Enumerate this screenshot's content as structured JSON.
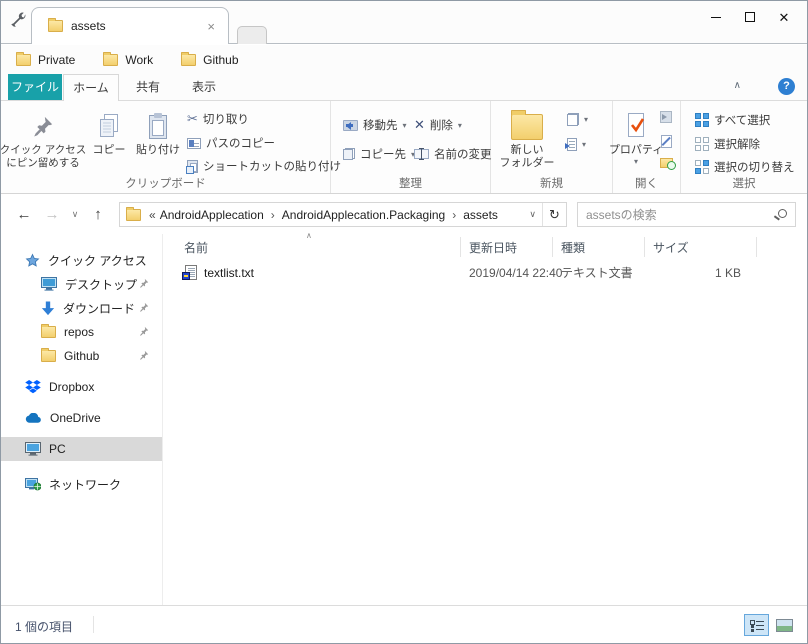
{
  "titlebar": {
    "tab": "assets",
    "bookmarks": [
      "Private",
      "Work",
      "Github"
    ]
  },
  "ribbon": {
    "file_tab": "ファイル",
    "tabs": [
      "ホーム",
      "共有",
      "表示"
    ],
    "pin_quick_access": [
      "クイック アクセス",
      "にピン留めする"
    ],
    "copy": "コピー",
    "paste": "貼り付け",
    "cut": "切り取り",
    "copy_path": "パスのコピー",
    "paste_shortcut": "ショートカットの貼り付け",
    "group_clipboard": "クリップボード",
    "move_to": "移動先",
    "copy_to": "コピー先",
    "delete": "削除",
    "rename": "名前の変更",
    "group_organize": "整理",
    "new_folder": [
      "新しい",
      "フォルダー"
    ],
    "group_new": "新規",
    "properties": "プロパティ",
    "group_open": "開く",
    "select_all": "すべて選択",
    "select_none": "選択解除",
    "invert_selection": "選択の切り替え",
    "group_select": "選択"
  },
  "navbar": {
    "breadcrumbs": [
      "AndroidApplecation",
      "AndroidApplecation.Packaging",
      "assets"
    ],
    "search_placeholder": "assetsの検索"
  },
  "sidebar": {
    "quick_access": "クイック アクセス",
    "pinned": [
      "デスクトップ",
      "ダウンロード",
      "repos",
      "Github"
    ],
    "dropbox": "Dropbox",
    "onedrive": "OneDrive",
    "pc": "PC",
    "network": "ネットワーク"
  },
  "files": {
    "columns": [
      "名前",
      "更新日時",
      "種類",
      "サイズ"
    ],
    "rows": [
      {
        "name": "textlist.txt",
        "modified": "2019/04/14 22:40",
        "type": "テキスト文書",
        "size": "1 KB"
      }
    ]
  },
  "statusbar": {
    "item_count": "1 個の項目"
  },
  "icons": {
    "back_arrow": "←",
    "forward_arrow": "→",
    "up_arrow": "↑",
    "history_chevron": "∨",
    "address_chevron": "∨",
    "refresh": "↻",
    "overflow": "«",
    "crumb_sep": "›",
    "tab_close": "×",
    "window_close": "✕",
    "scissors": "✂",
    "delete_x": "✕",
    "dropdown": "▾",
    "sort_asc": "∧",
    "ribbon_collapse": "∧",
    "help": "?"
  },
  "colors": {
    "accent_teal": "#18a1a9",
    "folder_yellow": "#f3cf6d",
    "selection_gray": "#d9d9d9",
    "select_blue": "#4aa0e4"
  }
}
